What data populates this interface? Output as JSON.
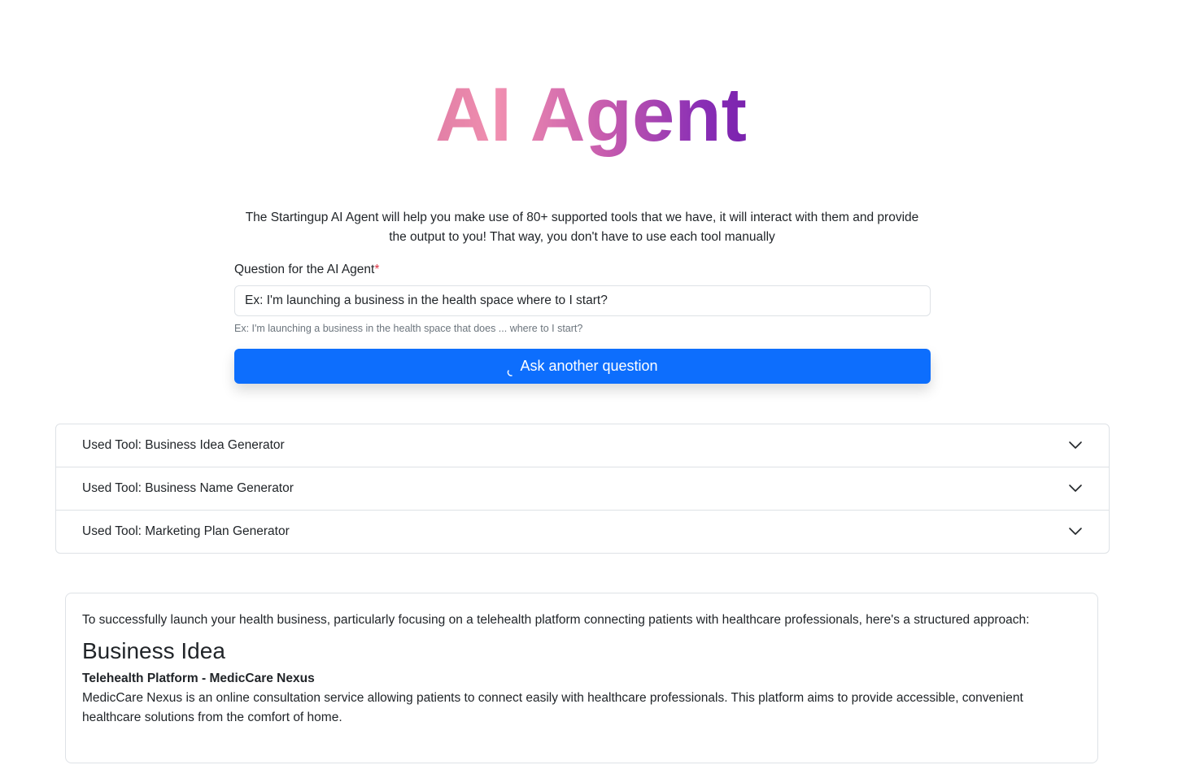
{
  "hero": {
    "title": "AI Agent"
  },
  "intro": {
    "text": "The Startingup AI Agent will help you make use of 80+ supported tools that we have, it will interact with them and provide the output to you! That way, you don't have to use each tool manually"
  },
  "form": {
    "label": "Question for the AI Agent",
    "required_mark": "*",
    "input_value": "Ex: I'm launching a business in the health space where to I start?",
    "help_text": "Ex: I'm launching a business in the health space that does ... where to I start?",
    "button_label": "Ask another question",
    "button_icon": "spinner-icon"
  },
  "tools": {
    "items": [
      {
        "label": "Used Tool: Business Idea Generator",
        "icon": "chevron-down-icon"
      },
      {
        "label": "Used Tool: Business Name Generator",
        "icon": "chevron-down-icon"
      },
      {
        "label": "Used Tool: Marketing Plan Generator",
        "icon": "chevron-down-icon"
      }
    ]
  },
  "result": {
    "intro": "To successfully launch your health business, particularly focusing on a telehealth platform connecting patients with healthcare professionals, here's a structured approach:",
    "heading": "Business Idea",
    "idea_title": "Telehealth Platform - MedicCare Nexus",
    "idea_description": "MedicCare Nexus is an online consultation service allowing patients to connect easily with healthcare professionals. This platform aims to provide accessible, convenient healthcare solutions from the comfort of home."
  },
  "colors": {
    "primary_button": "#0d6efd",
    "required": "#dc3545",
    "gradient_start": "#e27fa6",
    "gradient_end": "#7a22ae"
  }
}
